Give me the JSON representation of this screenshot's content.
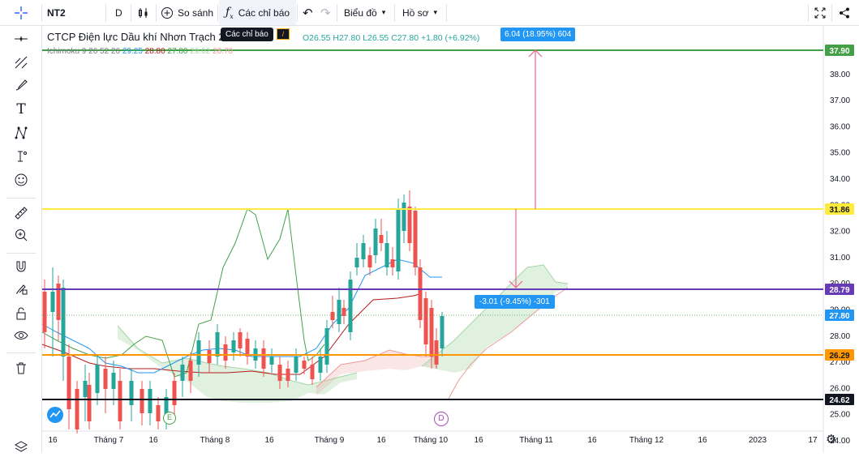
{
  "toolbar": {
    "symbol": "NT2",
    "interval": "D",
    "compare_label": "So sánh",
    "indicators_label": "Các chỉ báo",
    "chart_label": "Biểu đồ",
    "profile_label": "Hồ sơ"
  },
  "tooltip": {
    "text": "Các chỉ báo"
  },
  "legend": {
    "title": "CTCP Điện lực Dầu khí Nhơn Trạch 2",
    "o": "O26.55",
    "h": "H27.80",
    "l": "L26.55",
    "c": "C27.80",
    "chg": "+1.80 (+6.92%)",
    "ichimoku_label": "Ichimoku 9 26 52 26",
    "ich_values": [
      "29.25",
      "28.80",
      "27.80",
      "29.02",
      "28.70"
    ],
    "ich_colors": [
      "#2196f3",
      "#b71c1c",
      "#43a047",
      "#a5d6a7",
      "#ef9a9a"
    ]
  },
  "measure": {
    "up_label": "6.04 (18.95%) 604",
    "down_label": "-3.01 (-9.45%) -301"
  },
  "price_axis": {
    "ticks": [
      "38.00",
      "37.00",
      "36.00",
      "35.00",
      "34.00",
      "33.00",
      "32.00",
      "31.00",
      "30.00",
      "29.00",
      "28.00",
      "27.00",
      "26.00",
      "25.00",
      "24.00"
    ],
    "badges": [
      {
        "label": "37.90",
        "color": "#43a047",
        "text_color": "#ffffff"
      },
      {
        "label": "31.86",
        "color": "#ffeb3b",
        "text_color": "#131722"
      },
      {
        "label": "28.79",
        "color": "#673ab7",
        "text_color": "#ffffff"
      },
      {
        "label": "27.80",
        "color": "#2196f3",
        "text_color": "#ffffff"
      },
      {
        "label": "26.29",
        "color": "#ff9800",
        "text_color": "#131722"
      },
      {
        "label": "24.62",
        "color": "#131722",
        "text_color": "#ffffff"
      }
    ]
  },
  "time_axis": {
    "labels": [
      "16",
      "Tháng 7",
      "16",
      "Tháng 8",
      "16",
      "Tháng 9",
      "16",
      "Tháng 10",
      "16",
      "Tháng 11",
      "16",
      "Tháng 12",
      "16",
      "2023",
      "17"
    ]
  },
  "markers": {
    "earnings": "E",
    "dividend": "D"
  },
  "colors": {
    "up": "#26a69a",
    "down": "#ef5350"
  },
  "left_tools": [
    "crosshair-icon",
    "trend-line-icon",
    "fib-icon",
    "brush-icon",
    "text-icon",
    "pattern-icon",
    "projection-icon",
    "emoji-icon",
    "ruler-icon",
    "zoom-in-icon",
    "magnet-icon",
    "lock-drawing-icon",
    "lock-icon",
    "eye-icon",
    "trash-icon",
    "layers-icon"
  ]
}
